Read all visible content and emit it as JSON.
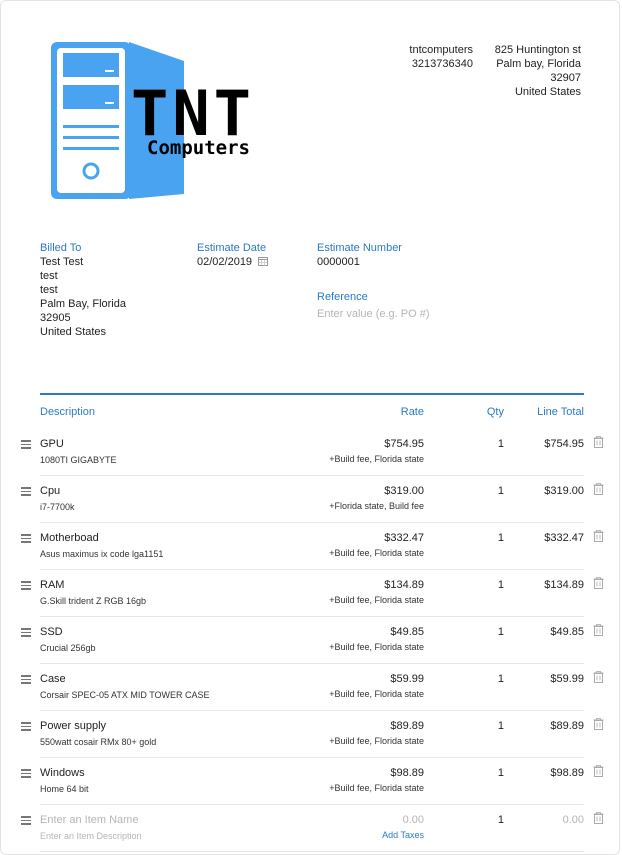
{
  "brand": {
    "logo_text": "TNT",
    "logo_subtext": "Computers",
    "logo_color": "#4aa3f0"
  },
  "company": {
    "name": "tntcomputers",
    "phone": "3213736340",
    "address_line1": "825 Huntington st",
    "address_line2": "Palm bay, Florida",
    "zip": "32907",
    "country": "United States"
  },
  "billed_to": {
    "label": "Billed To",
    "name": "Test Test",
    "line1": "test",
    "line2": "test",
    "city": "Palm Bay, Florida",
    "zip": "32905",
    "country": "United States"
  },
  "estimate_date": {
    "label": "Estimate Date",
    "value": "02/02/2019"
  },
  "estimate_number": {
    "label": "Estimate Number",
    "value": "0000001"
  },
  "reference": {
    "label": "Reference",
    "placeholder": "Enter value (e.g. PO #)"
  },
  "table": {
    "headers": {
      "description": "Description",
      "rate": "Rate",
      "qty": "Qty",
      "line_total": "Line Total"
    },
    "items": [
      {
        "name": "GPU",
        "desc": "1080TI GIGABYTE",
        "rate": "$754.95",
        "taxes": "+Build fee, Florida state",
        "qty": "1",
        "total": "$754.95"
      },
      {
        "name": "Cpu",
        "desc": "i7-7700k",
        "rate": "$319.00",
        "taxes": "+Florida state, Build fee",
        "qty": "1",
        "total": "$319.00"
      },
      {
        "name": "Motherboad",
        "desc": "Asus maximus ix code lga1151",
        "rate": "$332.47",
        "taxes": "+Build fee, Florida state",
        "qty": "1",
        "total": "$332.47"
      },
      {
        "name": "RAM",
        "desc": "G.Skill trident Z RGB 16gb",
        "rate": "$134.89",
        "taxes": "+Build fee, Florida state",
        "qty": "1",
        "total": "$134.89"
      },
      {
        "name": "SSD",
        "desc": "Crucial 256gb",
        "rate": "$49.85",
        "taxes": "+Build fee, Florida state",
        "qty": "1",
        "total": "$49.85"
      },
      {
        "name": "Case",
        "desc": "Corsair SPEC-05 ATX MID TOWER CASE",
        "rate": "$59.99",
        "taxes": "+Build fee, Florida state",
        "qty": "1",
        "total": "$59.99"
      },
      {
        "name": "Power supply",
        "desc": "550watt cosair RMx 80+ gold",
        "rate": "$89.89",
        "taxes": "+Build fee, Florida state",
        "qty": "1",
        "total": "$89.89"
      },
      {
        "name": "Windows",
        "desc": "Home 64 bit",
        "rate": "$98.89",
        "taxes": "+Build fee, Florida state",
        "qty": "1",
        "total": "$98.89"
      }
    ],
    "new_item": {
      "name_placeholder": "Enter an Item Name",
      "desc_placeholder": "Enter an Item Description",
      "rate": "0.00",
      "add_taxes": "Add Taxes",
      "qty": "1",
      "total": "0.00"
    }
  },
  "icons": {
    "calendar": "calendar-icon",
    "drag": "drag-handle-icon",
    "delete": "trash-icon"
  },
  "colors": {
    "accent": "#2a7bc4",
    "logo_blue": "#4aa3f0"
  }
}
